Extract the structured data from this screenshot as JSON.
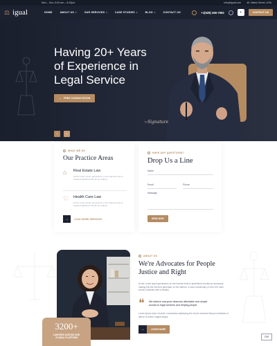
{
  "topbar": {
    "hours": "Mon – Sun: 8.00 am – 8.00pm",
    "email": "info@igual.com",
    "address": "45, Wales Street, USA"
  },
  "brand": {
    "name": "igual"
  },
  "nav": {
    "items": [
      {
        "label": "HOME",
        "dropdown": false
      },
      {
        "label": "ABOUT US",
        "dropdown": true
      },
      {
        "label": "OUR SERVICES",
        "dropdown": true
      },
      {
        "label": "CASE STUDIES",
        "dropdown": true
      },
      {
        "label": "BLOG",
        "dropdown": true
      },
      {
        "label": "CONTACT US",
        "dropdown": false
      }
    ],
    "phone": "+1(528) 456-7592",
    "contact_button": "CONTACT US"
  },
  "hero": {
    "title_line1": "Having 20+ Years",
    "title_line2": "of Experience in",
    "title_line3": "Legal Service",
    "cta_label": "FREE CONSULTATION",
    "signature": "Signature"
  },
  "practice": {
    "eyebrow": "WHAT WE DO",
    "title": "Our Practice Areas",
    "services": [
      {
        "name": "Real Estate Law",
        "desc": "At the Lorem ipsum generators on the Internet tend to repeat predefined chunks as making"
      },
      {
        "name": "Health Care Law",
        "desc": "At the Lorem ipsum generators on the Internet tend to repeat predefined chunks as making"
      }
    ],
    "more_label": "LOOK MORE SERVICES"
  },
  "contact_form": {
    "eyebrow": "HAVE ANY QUESTIONS?",
    "title": "Drop Us a Line",
    "name_label": "Name",
    "email_label": "Email",
    "phone_label": "Phone",
    "message_label": "Message",
    "send_label": "SEND NOW"
  },
  "about": {
    "eyebrow": "ABOUT US",
    "title": "We're Advocates for People Justice and Right",
    "para1": "At the Lorem ipsum generators on the Internet tend to predefined chunks as necessary making this the first true generator on the Internet. It uses a dictionary of over 200 Latin words combined with a handful",
    "quote": "We believe everyone deserves affordable and simple access to legal services and helping people.",
    "para2": "Lorem ipsum dolor sit amet, consectetur adipiscing elit, sed do eiusmod tempor incididunt ut labore et dolore magna aliqua.",
    "learn_label": "LEARN MORE",
    "stats_number": "3200+",
    "stats_caption": "LAWYERS ACROSS OUR GLOBAL PLATFORM"
  },
  "totop_label": "TOP",
  "colors": {
    "accent": "#b58b62",
    "dark": "#1c2230",
    "header": "#1c2230"
  }
}
